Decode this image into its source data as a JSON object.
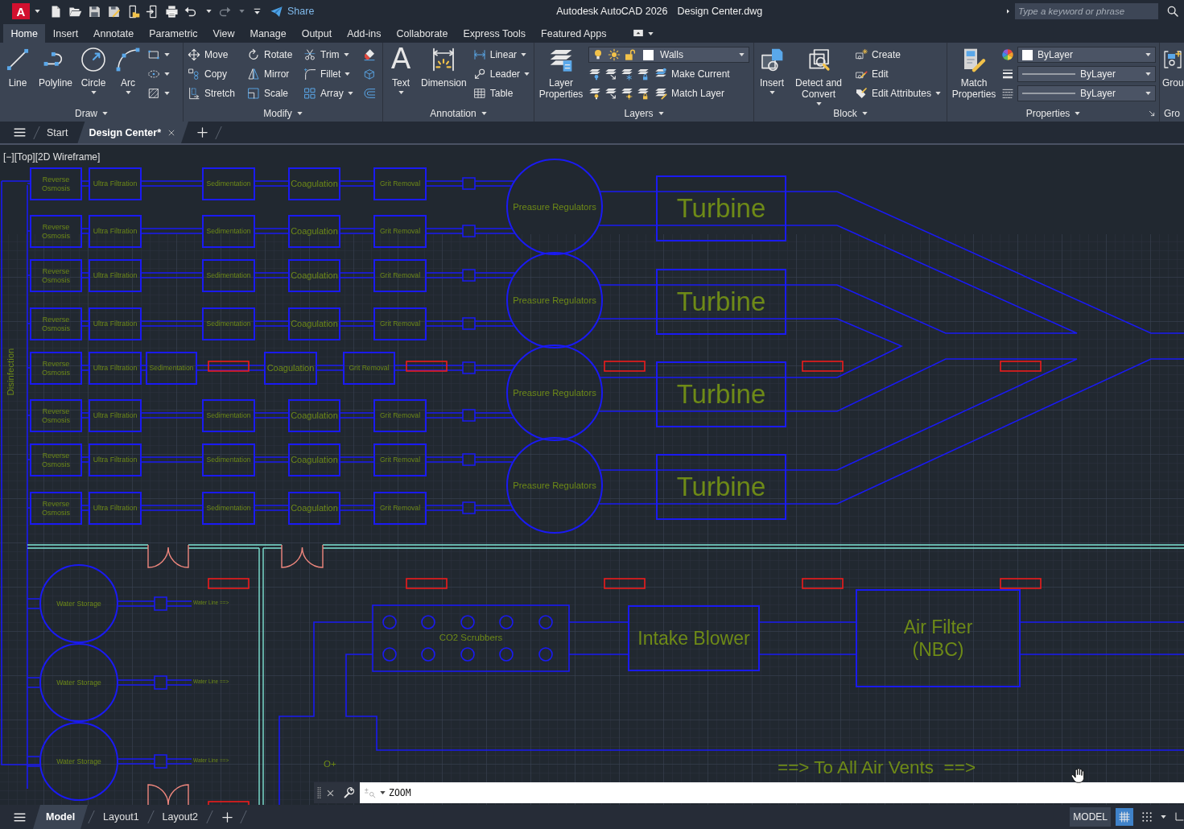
{
  "title_bar": {
    "logo": "A",
    "undo": {
      "disabled": false
    },
    "redo": {
      "disabled": true
    },
    "share": "Share",
    "app_name": "Autodesk AutoCAD 2026",
    "file_name": "Design Center.dwg",
    "search": {
      "placeholder": "Type a keyword or phrase"
    }
  },
  "ribbon_tabs": [
    {
      "label": "Home",
      "selected": true
    },
    {
      "label": "Insert",
      "selected": false
    },
    {
      "label": "Annotate",
      "selected": false
    },
    {
      "label": "Parametric",
      "selected": false
    },
    {
      "label": "View",
      "selected": false
    },
    {
      "label": "Manage",
      "selected": false
    },
    {
      "label": "Output",
      "selected": false
    },
    {
      "label": "Add-ins",
      "selected": false
    },
    {
      "label": "Collaborate",
      "selected": false
    },
    {
      "label": "Express Tools",
      "selected": false
    },
    {
      "label": "Featured Apps",
      "selected": false
    }
  ],
  "ribbon_panels": [
    {
      "title": "Draw",
      "expandable": true,
      "launcher": false,
      "columns": [
        {
          "kind": "large",
          "label": "Line",
          "dropdown": false
        },
        {
          "kind": "large",
          "label": "Polyline",
          "dropdown": false
        },
        {
          "kind": "large",
          "label": "Circle",
          "dropdown": true
        },
        {
          "kind": "large",
          "label": "Arc",
          "dropdown": true
        },
        {
          "kind": "rows",
          "rows": [
            [
              {
                "kind": "icon",
                "dropdown": true
              }
            ],
            [
              {
                "kind": "icon",
                "dropdown": true
              }
            ],
            [
              {
                "kind": "icon",
                "dropdown": true
              }
            ]
          ]
        }
      ]
    },
    {
      "title": "Modify",
      "expandable": true,
      "launcher": false,
      "columns": [
        {
          "kind": "rows",
          "rows": [
            [
              {
                "kind": "small",
                "label": "Move",
                "dropdown": false
              },
              {
                "kind": "small",
                "label": "Rotate",
                "dropdown": false
              },
              {
                "kind": "small",
                "label": "Trim",
                "dropdown": true
              },
              {
                "kind": "icon",
                "dropdown": false
              }
            ],
            [
              {
                "kind": "small",
                "label": "Copy",
                "dropdown": false
              },
              {
                "kind": "small",
                "label": "Mirror",
                "dropdown": false
              },
              {
                "kind": "small",
                "label": "Fillet",
                "dropdown": true
              },
              {
                "kind": "icon",
                "dropdown": false
              }
            ],
            [
              {
                "kind": "small",
                "label": "Stretch",
                "dropdown": false
              },
              {
                "kind": "small",
                "label": "Scale",
                "dropdown": false
              },
              {
                "kind": "small",
                "label": "Array",
                "dropdown": true
              },
              {
                "kind": "icon",
                "dropdown": false
              }
            ]
          ]
        }
      ]
    },
    {
      "title": "Annotation",
      "expandable": true,
      "launcher": false,
      "columns": [
        {
          "kind": "glyph",
          "glyph": "A",
          "label": "Text",
          "dropdown": true
        },
        {
          "kind": "large",
          "label": "Dimension",
          "dropdown": false
        },
        {
          "kind": "rows",
          "rows": [
            [
              {
                "kind": "small",
                "label": "Linear",
                "dropdown": true
              }
            ],
            [
              {
                "kind": "small",
                "label": "Leader",
                "dropdown": true
              }
            ],
            [
              {
                "kind": "small",
                "label": "Table",
                "dropdown": false
              }
            ]
          ]
        }
      ]
    },
    {
      "title": "Layers",
      "expandable": true,
      "launcher": false,
      "columns": [
        {
          "kind": "large",
          "label": "Layer Properties",
          "dropdown": false
        },
        {
          "kind": "rows",
          "rows": [
            [
              {
                "kind": "layer_combo",
                "value": "Walls"
              }
            ],
            [
              {
                "kind": "icon",
                "dropdown": false
              },
              {
                "kind": "icon",
                "dropdown": false
              },
              {
                "kind": "icon",
                "dropdown": false
              },
              {
                "kind": "icon",
                "dropdown": false
              },
              {
                "kind": "small",
                "label": "Make Current",
                "dropdown": false
              }
            ],
            [
              {
                "kind": "icon",
                "dropdown": false
              },
              {
                "kind": "icon",
                "dropdown": false
              },
              {
                "kind": "icon",
                "dropdown": false
              },
              {
                "kind": "icon",
                "dropdown": false
              },
              {
                "kind": "small",
                "label": "Match Layer",
                "dropdown": false
              }
            ]
          ]
        }
      ]
    },
    {
      "title": "Block",
      "expandable": true,
      "launcher": false,
      "columns": [
        {
          "kind": "large",
          "label": "Insert",
          "dropdown": true
        },
        {
          "kind": "large",
          "label": "Detect and Convert",
          "dropdown": true
        },
        {
          "kind": "rows",
          "rows": [
            [
              {
                "kind": "small",
                "label": "Create",
                "dropdown": false
              }
            ],
            [
              {
                "kind": "small",
                "label": "Edit",
                "dropdown": false
              }
            ],
            [
              {
                "kind": "small",
                "label": "Edit Attributes",
                "dropdown": true
              }
            ]
          ]
        }
      ]
    },
    {
      "title": "Properties",
      "expandable": true,
      "launcher": true,
      "columns": [
        {
          "kind": "large",
          "label": "Match Properties",
          "dropdown": false
        },
        {
          "kind": "rows",
          "rows": [
            [
              {
                "kind": "icon",
                "dropdown": false
              },
              {
                "kind": "color_combo",
                "value": "ByLayer"
              }
            ],
            [
              {
                "kind": "icon",
                "dropdown": false
              },
              {
                "kind": "line_combo",
                "value": "ByLayer"
              }
            ],
            [
              {
                "kind": "icon",
                "dropdown": false
              },
              {
                "kind": "line_combo",
                "value": "ByLayer"
              }
            ]
          ]
        }
      ]
    },
    {
      "title": "Gro",
      "expandable": false,
      "launcher": false,
      "columns": [
        {
          "kind": "large",
          "label": "Grou",
          "dropdown": false
        }
      ]
    }
  ],
  "file_tabs": [
    {
      "label": "Start",
      "selected": false,
      "closable": false
    },
    {
      "label": "Design Center*",
      "selected": true,
      "closable": true
    }
  ],
  "drawing": {
    "viewport_controls": [
      "[−]",
      "[Top]",
      "[2D Wireframe]"
    ],
    "side_label": "Disinfection",
    "treatment_trains": [
      {
        "kind": "standard",
        "stages": [
          "Reverse Osmosis",
          "Ultra Filtration",
          "Sedimentation",
          "Coagulation",
          "Grit Removal"
        ]
      },
      {
        "kind": "standard",
        "stages": [
          "Reverse Osmosis",
          "Ultra Filtration",
          "Sedimentation",
          "Coagulation",
          "Grit Removal"
        ]
      },
      {
        "kind": "standard",
        "stages": [
          "Reverse Osmosis",
          "Ultra Filtration",
          "Sedimentation",
          "Coagulation",
          "Grit Removal"
        ]
      },
      {
        "kind": "standard",
        "stages": [
          "Reverse Osmosis",
          "Ultra Filtration",
          "Sedimentation",
          "Coagulation",
          "Grit Removal"
        ]
      },
      {
        "kind": "compact",
        "stages": [
          "Reverse Osmosis",
          "Ultra Filtration",
          "Sedimentation",
          "Coagulation",
          "Grit Removal"
        ]
      },
      {
        "kind": "standard",
        "stages": [
          "Reverse Osmosis",
          "Ultra Filtration",
          "Sedimentation",
          "Coagulation",
          "Grit Removal"
        ]
      },
      {
        "kind": "standard",
        "stages": [
          "Reverse Osmosis",
          "Ultra Filtration",
          "Sedimentation",
          "Coagulation",
          "Grit Removal"
        ]
      },
      {
        "kind": "standard",
        "stages": [
          "Reverse Osmosis",
          "Ultra Filtration",
          "Sedimentation",
          "Coagulation",
          "Grit Removal"
        ]
      }
    ],
    "pressure_regulators": [
      "Preasure Regulators",
      "Preasure Regulators",
      "Preasure Regulators",
      "Preasure Regulators"
    ],
    "turbines": [
      "Turbine",
      "Turbine",
      "Turbine",
      "Turbine"
    ],
    "water_tanks": [
      {
        "label": "Water Storage",
        "line_label": "Water Line ==>"
      },
      {
        "label": "Water Storage",
        "line_label": "Water Line ==>"
      },
      {
        "label": "Water Storage",
        "line_label": "Water Line ==>"
      }
    ],
    "scrubber_label": "CO2 Scrubbers",
    "blower_label": "Intake Blower",
    "filter_label": "Air Filter (NBC)",
    "marker_label": "O+",
    "vent_note": "==> To All Air Vents  ==>"
  },
  "command_line": {
    "value": "ZOOM"
  },
  "layout_tabs": [
    {
      "label": "Model",
      "selected": true
    },
    {
      "label": "Layout1",
      "selected": false
    },
    {
      "label": "Layout2",
      "selected": false
    }
  ],
  "status_bar": {
    "space": "MODEL",
    "grid": {
      "on": true
    },
    "snap": {
      "on": false
    }
  }
}
